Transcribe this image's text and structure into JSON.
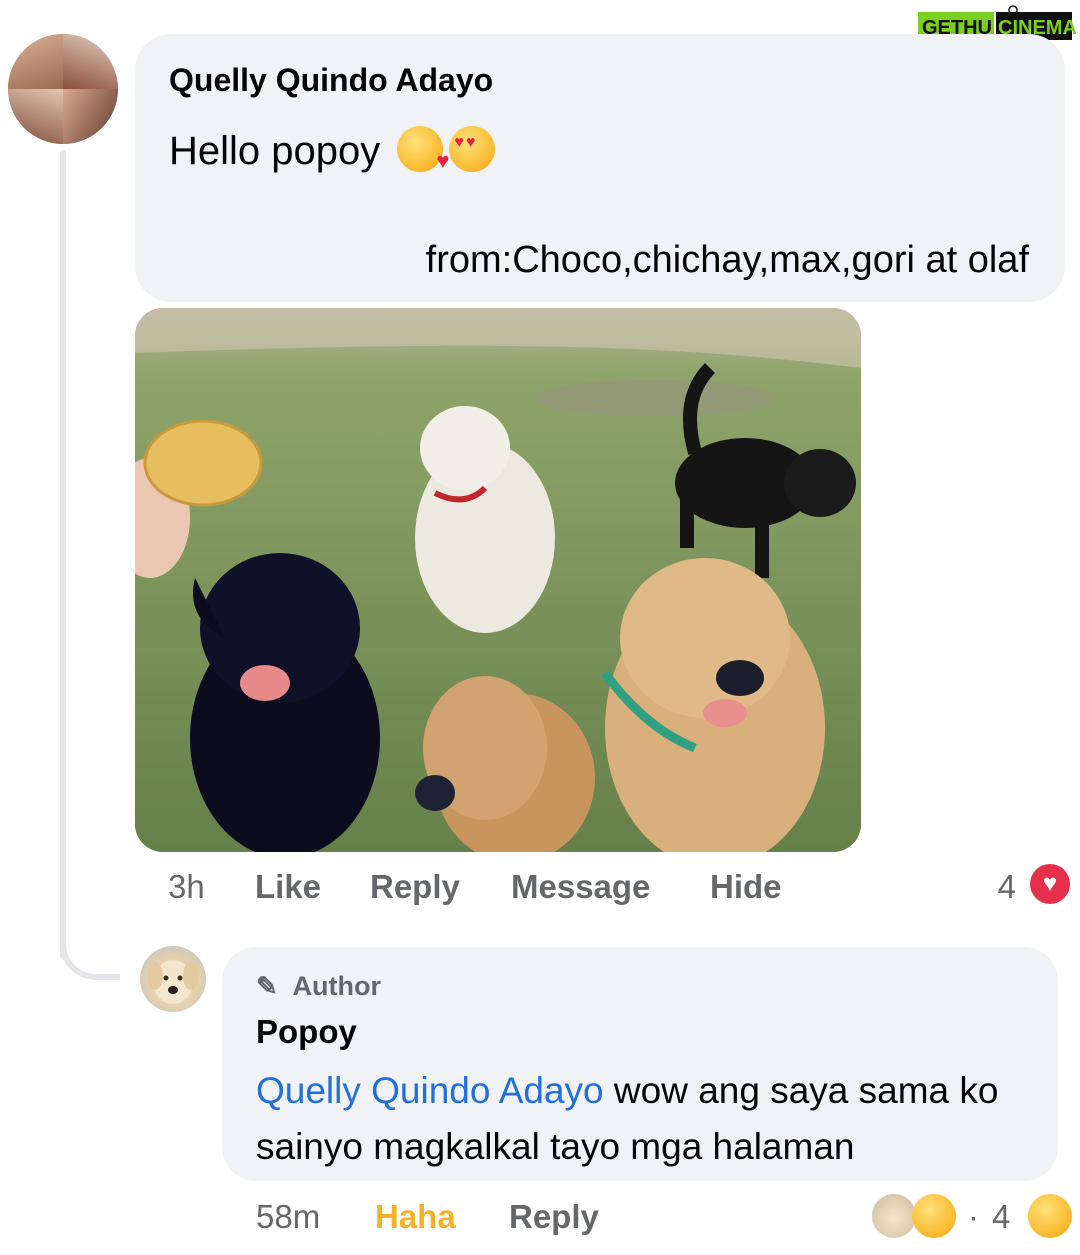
{
  "watermark": {
    "part1": "GETHU",
    "part2": "CINEMA",
    "color1": "#7ccf21",
    "color2": "#7ccf21"
  },
  "comment": {
    "author": "Quelly Quindo Adayo",
    "text": "Hello popoy",
    "emojis": [
      "face-blowing-kiss",
      "smiling-face-with-heart-eyes"
    ],
    "signature": "from:Choco,chichay,max,gori at olaf",
    "time": "3h",
    "actions": {
      "like": "Like",
      "reply": "Reply",
      "message": "Message",
      "hide": "Hide"
    },
    "reaction_count": "4",
    "reaction_icon": "heart-icon"
  },
  "reply": {
    "badge": "Author",
    "author": "Popoy",
    "mention": "Quelly Quindo Adayo",
    "text": " wow ang saya sama ko sainyo magkalkal tayo mga halaman",
    "time": "58m",
    "actions": {
      "haha": "Haha",
      "reply": "Reply"
    },
    "reaction_count": "4",
    "reaction_separator": "·"
  },
  "colors": {
    "bubble": "#f0f2f5",
    "mention": "#216fdb",
    "haha": "#f7b125",
    "heart": "#e4304a",
    "meta": "#65676b"
  }
}
